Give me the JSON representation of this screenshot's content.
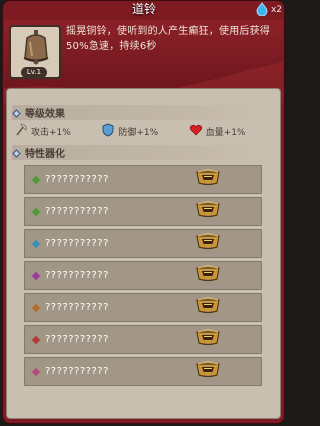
{
  "title": "道铃",
  "gem": {
    "count": "x2",
    "color": "#3db4f0"
  },
  "item": {
    "icon": "bell-icon",
    "level_label": "Lv.1",
    "description": "摇晃铜铃，使听到的人产生癫狂，使用后获得50%急速，持续6秒"
  },
  "level_effects": {
    "header": "等级效果",
    "bonuses": [
      {
        "icon": "axe-icon",
        "label": "攻击+1%"
      },
      {
        "icon": "shield-icon",
        "label": "防御+1%"
      },
      {
        "icon": "heart-icon",
        "label": "血量+1%"
      }
    ]
  },
  "traits": {
    "header": "特性器化",
    "rows": [
      {
        "name": "???????????",
        "gem_color": "#4f9a3a",
        "badge_icon": "rank-badge-icon"
      },
      {
        "name": "???????????",
        "gem_color": "#4f9a3a",
        "badge_icon": "rank-badge-icon"
      },
      {
        "name": "???????????",
        "gem_color": "#3a8fb4",
        "badge_icon": "rank-badge-icon"
      },
      {
        "name": "???????????",
        "gem_color": "#9a3a9a",
        "badge_icon": "rank-badge-icon"
      },
      {
        "name": "???????????",
        "gem_color": "#b46a28",
        "badge_icon": "rank-badge-icon"
      },
      {
        "name": "???????????",
        "gem_color": "#b43a3a",
        "badge_icon": "rank-badge-icon"
      },
      {
        "name": "???????????",
        "gem_color": "#b44a7a",
        "badge_icon": "rank-badge-icon"
      }
    ]
  }
}
